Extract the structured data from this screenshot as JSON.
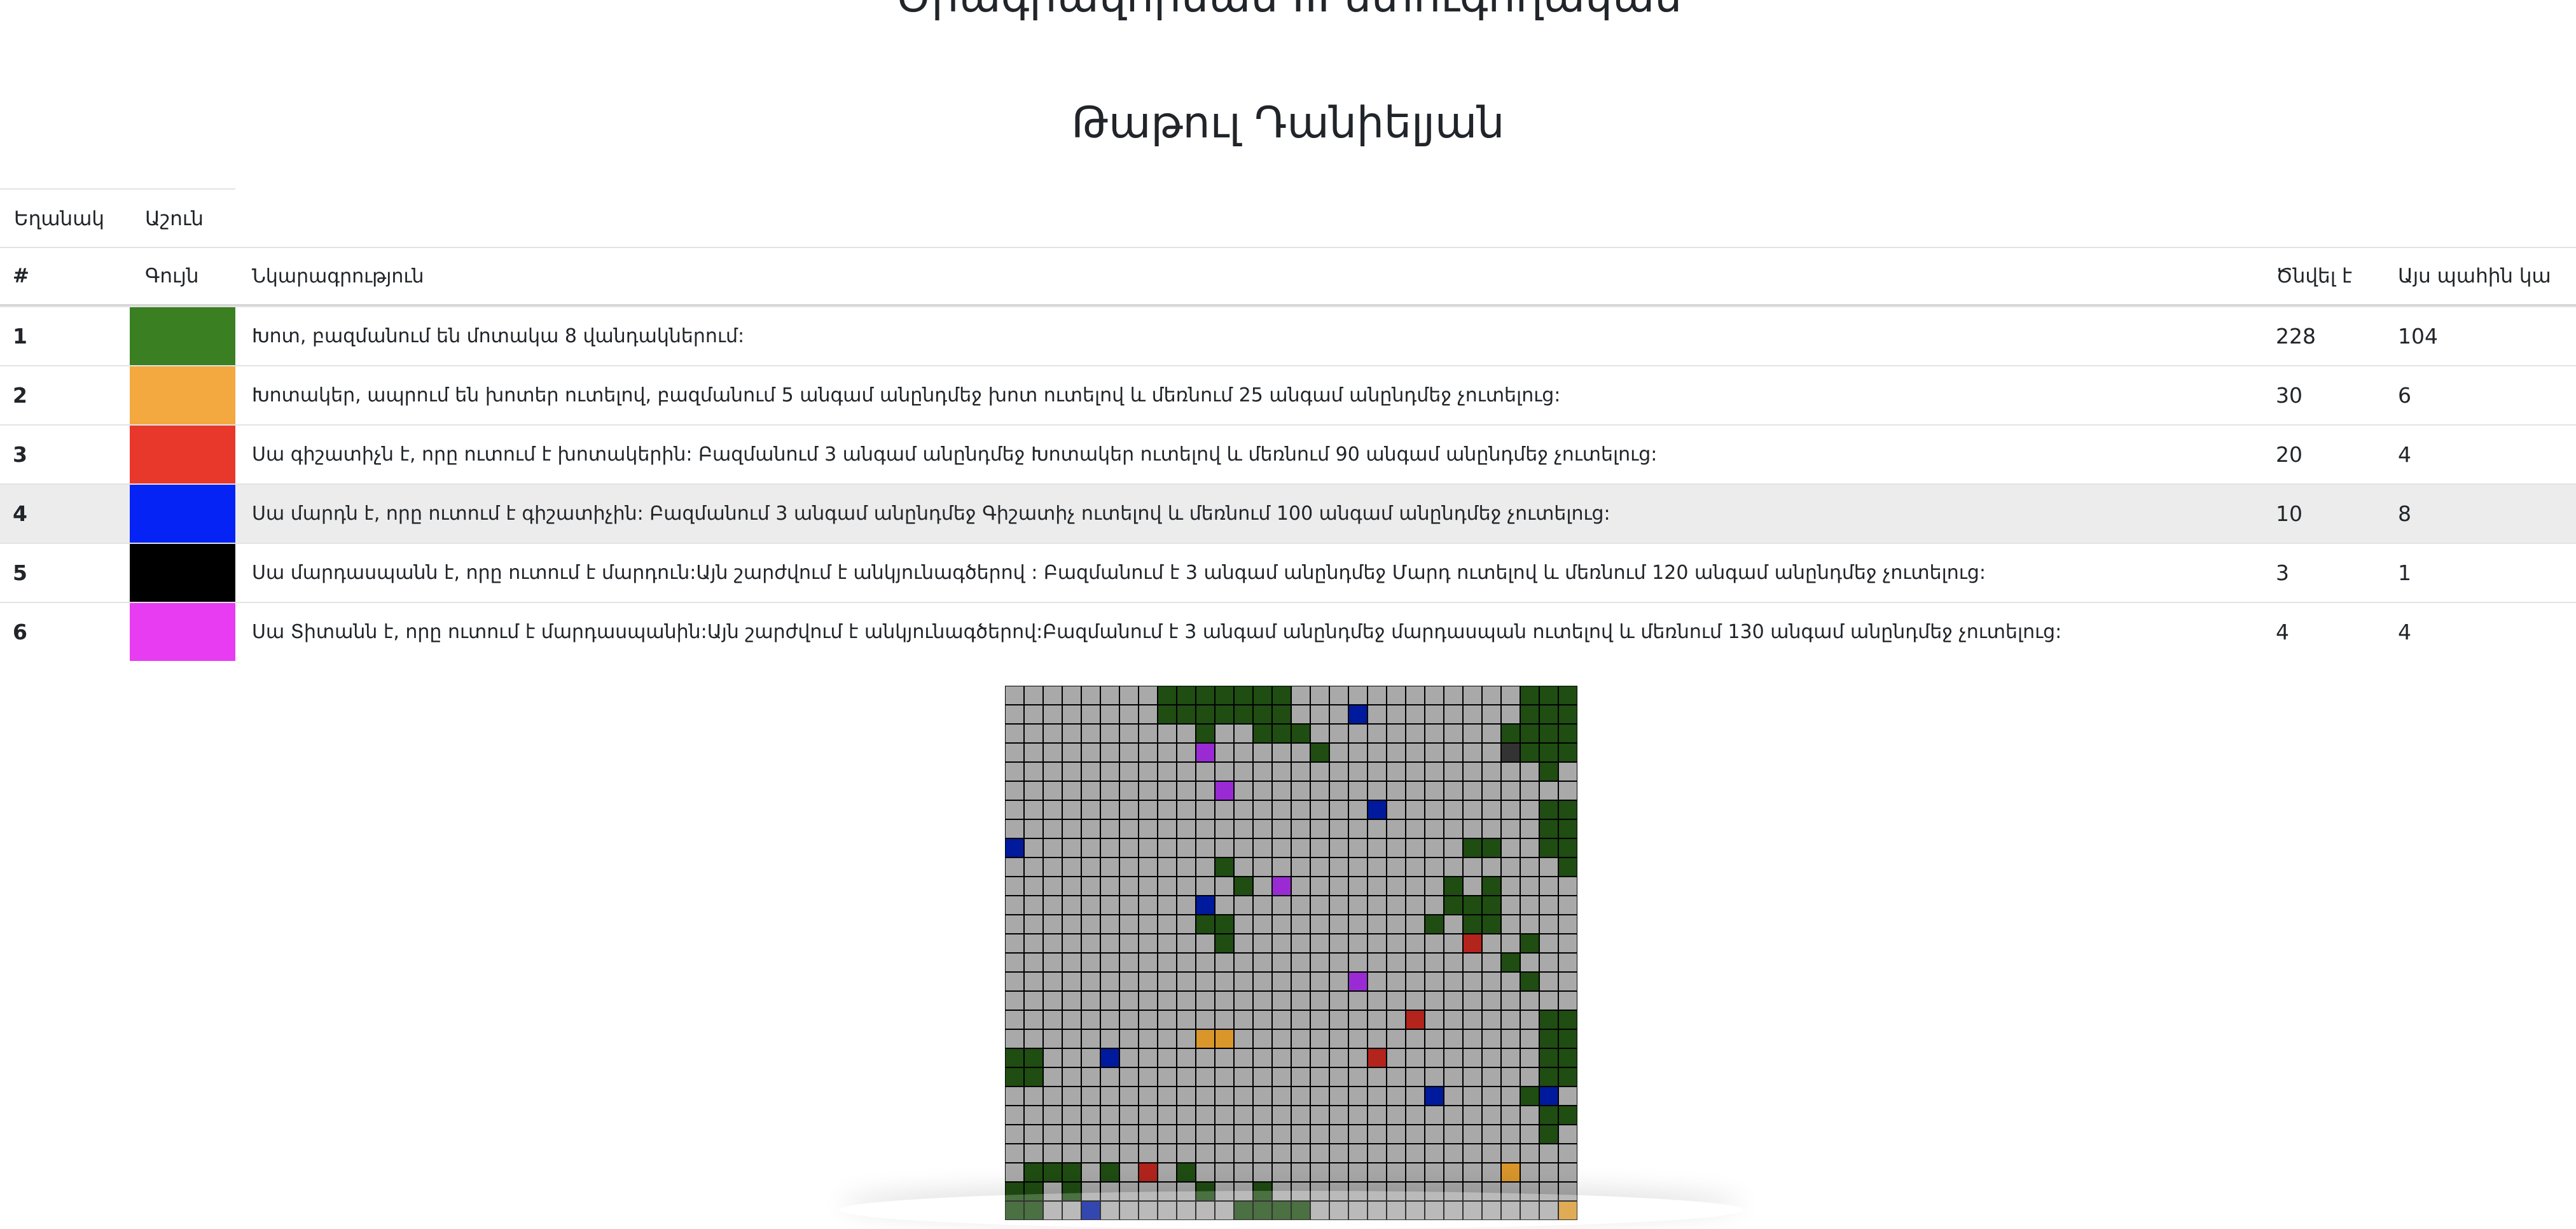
{
  "header": {
    "title": "Ծրագրավորման III ստուգողական",
    "author": "Թաթուլ Դանիելյան"
  },
  "info": {
    "label_left": "Եղանակ",
    "label_right": "Աշուն"
  },
  "table": {
    "columns": {
      "num": "#",
      "color": "Գույն",
      "desc": "Նկարագրություն",
      "born": "Ծնվել է",
      "alive": "Այս պահին կա"
    },
    "rows": [
      {
        "num": "1",
        "color": "#3a7f22",
        "desc": "Խոտ, բազմանում են մոտակա 8 վանդակներում:",
        "born": "228",
        "alive": "104"
      },
      {
        "num": "2",
        "color": "#f3a93f",
        "desc": "Խոտակեր, ապրում են խոտեր ուտելով, բազմանում 5 անգամ անընդմեջ խոտ ուտելով և մեռնում 25 անգամ անընդմեջ չուտելուց:",
        "born": "30",
        "alive": "6"
      },
      {
        "num": "3",
        "color": "#e8382b",
        "desc": "Սա գիշատիչն է, որը ուտում է խոտակերին: Բազմանում 3 անգամ անընդմեջ Խոտակեր ուտելով և մեռնում 90 անգամ անընդմեջ չուտելուց:",
        "born": "20",
        "alive": "4"
      },
      {
        "num": "4",
        "color": "#0523f5",
        "desc": "Սա մարդն է, որը ուտում է գիշատիչին: Բազմանում 3 անգամ անընդմեջ Գիշատիչ ուտելով և մեռնում 100 անգամ անընդմեջ չուտելուց:",
        "born": "10",
        "alive": "8"
      },
      {
        "num": "5",
        "color": "#000000",
        "desc": "Սա մարդասպանն է, որը ուտում է մարդուն:Այն շարժվում է անկյունագծերով : Բազմանում է 3 անգամ անընդմեջ Մարդ ուտելով և մեռնում 120 անգամ անընդմեջ չուտելուց:",
        "born": "3",
        "alive": "1"
      },
      {
        "num": "6",
        "color": "#e83cf2",
        "desc": "Սա Տիտանն է, որը ուտում է մարդասպանին:Այն շարժվում է անկյունագծերով:Բազմանում է 3 անգամ անընդմեջ մարդասպան ուտելով և մեռնում 130 անգամ անընդմեջ չուտելուց:",
        "born": "4",
        "alive": "4"
      }
    ]
  },
  "grid": {
    "cols": 30,
    "rows": 28,
    "colors": {
      "empty": "#a9a9a9",
      "grass": "#1f4d12",
      "grass_eater": "#d8962b",
      "predator": "#b3241d",
      "human": "#001a9e",
      "killer": "#333333",
      "titan": "#9a2bd4",
      "line": "#000000"
    },
    "cells": {
      "grass": [
        [
          8,
          0
        ],
        [
          9,
          0
        ],
        [
          10,
          0
        ],
        [
          11,
          0
        ],
        [
          12,
          0
        ],
        [
          13,
          0
        ],
        [
          14,
          0
        ],
        [
          27,
          0
        ],
        [
          28,
          0
        ],
        [
          29,
          0
        ],
        [
          8,
          1
        ],
        [
          9,
          1
        ],
        [
          10,
          1
        ],
        [
          11,
          1
        ],
        [
          12,
          1
        ],
        [
          13,
          1
        ],
        [
          14,
          1
        ],
        [
          27,
          1
        ],
        [
          28,
          1
        ],
        [
          29,
          1
        ],
        [
          10,
          2
        ],
        [
          13,
          2
        ],
        [
          14,
          2
        ],
        [
          15,
          2
        ],
        [
          26,
          2
        ],
        [
          27,
          2
        ],
        [
          28,
          2
        ],
        [
          29,
          2
        ],
        [
          16,
          3
        ],
        [
          27,
          3
        ],
        [
          28,
          3
        ],
        [
          29,
          3
        ],
        [
          28,
          4
        ],
        [
          28,
          6
        ],
        [
          29,
          6
        ],
        [
          28,
          7
        ],
        [
          29,
          7
        ],
        [
          28,
          8
        ],
        [
          29,
          8
        ],
        [
          24,
          8
        ],
        [
          25,
          8
        ],
        [
          29,
          9
        ],
        [
          11,
          9
        ],
        [
          12,
          10
        ],
        [
          23,
          10
        ],
        [
          25,
          10
        ],
        [
          23,
          11
        ],
        [
          24,
          11
        ],
        [
          25,
          11
        ],
        [
          10,
          12
        ],
        [
          11,
          12
        ],
        [
          22,
          12
        ],
        [
          24,
          12
        ],
        [
          25,
          12
        ],
        [
          11,
          13
        ],
        [
          27,
          13
        ],
        [
          26,
          14
        ],
        [
          27,
          15
        ],
        [
          28,
          17
        ],
        [
          29,
          17
        ],
        [
          28,
          18
        ],
        [
          29,
          18
        ],
        [
          0,
          19
        ],
        [
          1,
          19
        ],
        [
          28,
          19
        ],
        [
          29,
          19
        ],
        [
          0,
          20
        ],
        [
          1,
          20
        ],
        [
          28,
          20
        ],
        [
          29,
          20
        ],
        [
          27,
          21
        ],
        [
          28,
          22
        ],
        [
          29,
          22
        ],
        [
          28,
          23
        ],
        [
          1,
          25
        ],
        [
          2,
          25
        ],
        [
          3,
          25
        ],
        [
          5,
          25
        ],
        [
          9,
          25
        ],
        [
          0,
          26
        ],
        [
          1,
          26
        ],
        [
          3,
          26
        ],
        [
          10,
          26
        ],
        [
          13,
          26
        ],
        [
          0,
          27
        ],
        [
          1,
          27
        ],
        [
          12,
          27
        ],
        [
          13,
          27
        ],
        [
          14,
          27
        ],
        [
          15,
          27
        ]
      ],
      "grass_eater": [
        [
          10,
          18
        ],
        [
          11,
          18
        ],
        [
          26,
          25
        ],
        [
          29,
          27
        ]
      ],
      "predator": [
        [
          24,
          13
        ],
        [
          21,
          17
        ],
        [
          19,
          19
        ],
        [
          7,
          25
        ]
      ],
      "human": [
        [
          18,
          1
        ],
        [
          19,
          6
        ],
        [
          0,
          8
        ],
        [
          10,
          11
        ],
        [
          5,
          19
        ],
        [
          22,
          21
        ],
        [
          28,
          21
        ],
        [
          4,
          27
        ]
      ],
      "killer": [
        [
          26,
          3
        ]
      ],
      "titan": [
        [
          10,
          3
        ],
        [
          11,
          5
        ],
        [
          14,
          10
        ],
        [
          18,
          15
        ]
      ]
    }
  }
}
